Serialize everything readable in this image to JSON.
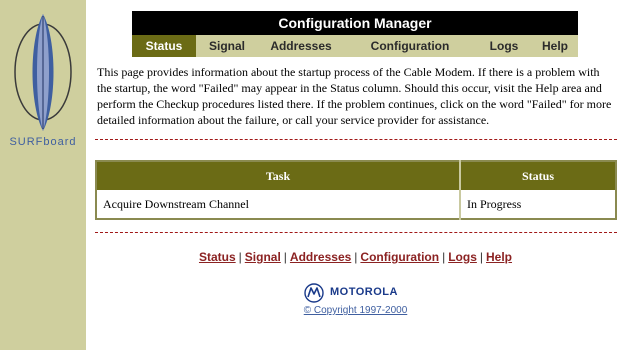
{
  "sidebar": {
    "logo_text": "SURFboard",
    "logo_icon": "surfboard-icon"
  },
  "header": {
    "title": "Configuration Manager"
  },
  "nav": {
    "items": [
      {
        "label": "Status",
        "active": true
      },
      {
        "label": "Signal"
      },
      {
        "label": "Addresses"
      },
      {
        "label": "Configuration"
      },
      {
        "label": "Logs"
      },
      {
        "label": "Help"
      }
    ]
  },
  "intro": {
    "text": "This page provides information about the startup process of the Cable Modem. If there is a problem with the startup, the word \"Failed\" may appear in the Status column. Should this occur, visit the Help area and perform the Checkup procedures listed there. If the problem continues, click on the word \"Failed\" for more detailed information about the failure, or call your service provider for assistance."
  },
  "table": {
    "headers": {
      "task": "Task",
      "status": "Status"
    },
    "rows": [
      {
        "task": "Acquire Downstream Channel",
        "status": "In Progress"
      }
    ]
  },
  "footer_nav": {
    "items": [
      "Status",
      "Signal",
      "Addresses",
      "Configuration",
      "Logs",
      "Help"
    ],
    "separator": "|"
  },
  "brand": {
    "name": "MOTOROLA",
    "logo_icon": "motorola-batwing-icon"
  },
  "copyright": "© Copyright 1997-2000",
  "colors": {
    "sidebar": "#cfcf9e",
    "nav_active": "#6b6b15",
    "link": "#8b2222",
    "divider": "#a01818",
    "logo_blue": "#3f5fa0"
  }
}
